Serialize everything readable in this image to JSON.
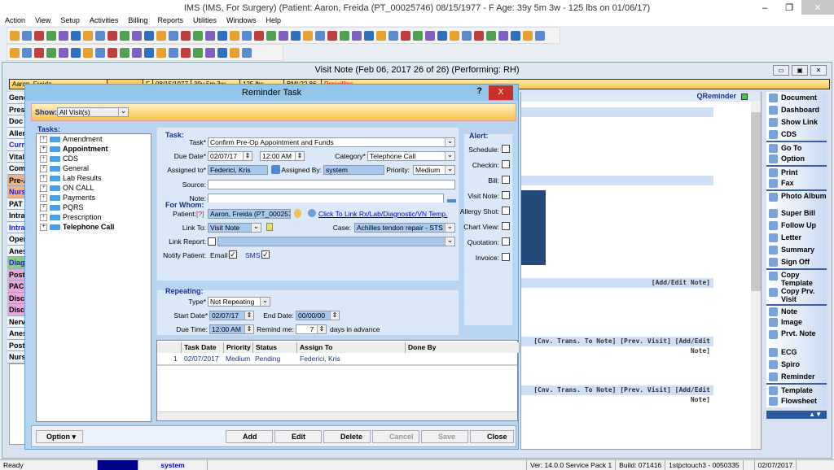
{
  "app": {
    "title": "IMS (IMS, For Surgery)    (Patient: Aaron, Freida  (PT_00025746) 08/15/1977 - F Age: 39y 5m 3w - 125 lbs on 01/06/17)"
  },
  "menu": [
    "Action",
    "View",
    "Setup",
    "Activities",
    "Billing",
    "Reports",
    "Utilities",
    "Windows",
    "Help"
  ],
  "visit_note": {
    "title": "Visit Note (Feb 06, 2017   26 of 26) (Performing: RH)",
    "patient_bar": [
      "Aaron, Freida",
      "F",
      "08/15/1977",
      "39y 5m 3w",
      "125 lbs",
      "BMI:22.86",
      "Penicillins"
    ],
    "left_sections": [
      "Gene",
      "Pres",
      "Doc",
      "Aller",
      "Curre",
      "Vital",
      "Comp",
      "Pre-A",
      "Nurs",
      "PAT",
      "Intra",
      "Intra",
      "Oper",
      "Anes",
      "Diag",
      "Post",
      "PACI",
      "Disc",
      "Disc",
      "Nerv",
      "Anes",
      "Post",
      "Nurs"
    ],
    "qreminder": "QReminder",
    "links": {
      "add_edit": "[Add/Edit Note]",
      "cnv": "[Cnv. Trans. To Note]",
      "prev": "[Prev. Visit]"
    },
    "right_tools": [
      "Document",
      "Dashboard",
      "Show Link",
      "CDS",
      "Go To",
      "Option",
      "Print",
      "Fax",
      "Photo Album",
      "Super Bill",
      "Follow Up",
      "Letter",
      "Summary",
      "Sign Off",
      "Copy Template",
      "Copy Prv. Visit",
      "Note",
      "Image",
      "Prvt. Note",
      "ECG",
      "Spiro",
      "Reminder",
      "Template",
      "Flowsheet"
    ]
  },
  "dialog": {
    "title": "Reminder Task",
    "help": "?",
    "close": "X",
    "show_label": "Show:",
    "show_value": "All Visit(s)",
    "tasks_label": "Tasks:",
    "tree": [
      "Amendment",
      "Appointment",
      "CDS",
      "General",
      "Lab Results",
      "ON CALL",
      "Payments",
      "PQRS",
      "Prescription",
      "Telephone Call"
    ],
    "task": {
      "group": "Task:",
      "task_label": "Task*",
      "task_value": "Confirm Pre-Op Appointment and Funds",
      "due_label": "Due Date*",
      "due_date": "02/07/17",
      "due_time": "12:00 AM",
      "category_label": "Category*",
      "category": "Telephone Call",
      "assigned_to_label": "Assigned to*",
      "assigned_to": "Federici, Kris",
      "assigned_by_label": "Assigned By:",
      "assigned_by": "system",
      "priority_label": "Priority:",
      "priority": "Medium",
      "source_label": "Source:",
      "source": "",
      "note_label": "Note:",
      "note": ""
    },
    "for_whom": {
      "group": "For Whom:",
      "patient_label": "Patient:",
      "patient_q": "[?]",
      "patient": "Aaron, Freida  (PT_00025746)",
      "link_text": "Click To Link Rx/Lab/Diagnostic/VN Temp.",
      "link_to_label": "Link To:",
      "link_to": "Visit Note",
      "case_label": "Case:",
      "case": "Achilles tendon repair  -  STS - 02/06/17",
      "link_report_label": "Link Report:",
      "notify_label": "Notify Patient:",
      "email": "Email",
      "sms": "SMS"
    },
    "repeating": {
      "group": "Repeating:",
      "type_label": "Type*",
      "type": "Not Repeating",
      "start_label": "Start Date*",
      "start": "02/07/17",
      "end_label": "End Date:",
      "end": "00/00/00",
      "due_time_label": "Due Time:",
      "due_time": "12:00 AM",
      "remind_label": "Remind me:",
      "remind": "7",
      "remind_suffix": "days in advance"
    },
    "alert": {
      "group": "Alert:",
      "items": [
        "Schedule:",
        "Checkin:",
        "Bill:",
        "Visit Note:",
        "Allergy Shot:",
        "Chart View:",
        "Quotation:",
        "Invoice:"
      ]
    },
    "grid": {
      "headers": [
        "Task Date",
        "Priority",
        "Status",
        "Assign To",
        "Done By"
      ],
      "rows": [
        {
          "n": "1",
          "date": "02/07/2017",
          "priority": "Medium",
          "status": "Pending",
          "assign": "Federici, Kris",
          "done": ""
        }
      ]
    },
    "buttons": {
      "option": "Option",
      "add": "Add",
      "edit": "Edit",
      "delete": "Delete",
      "cancel": "Cancel",
      "save": "Save",
      "close": "Close"
    }
  },
  "status": {
    "ready": "Ready",
    "user": "system",
    "version": "Ver: 14.0.0 Service Pack 1",
    "build": "Build: 071416",
    "station": "1stpctouch3 - 0050335",
    "date": "02/07/2017"
  }
}
